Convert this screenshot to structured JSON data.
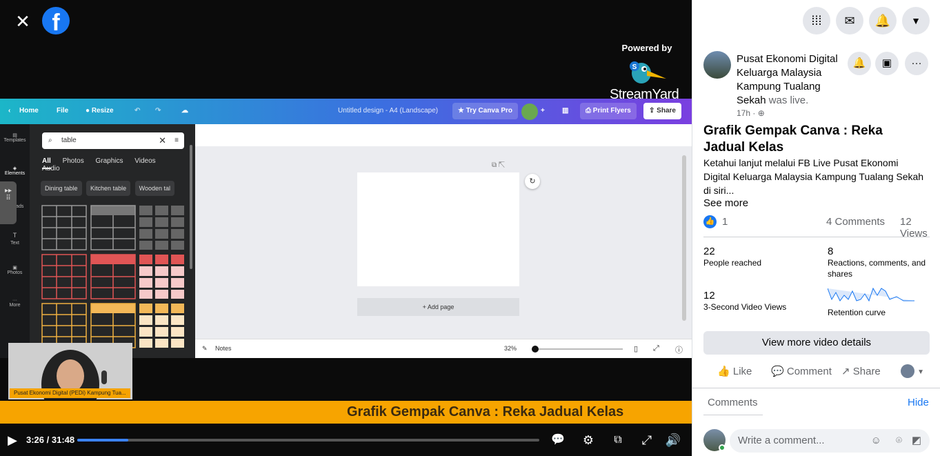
{
  "video": {
    "close_label": "✕",
    "logo": "f",
    "streamyard_powered": "Powered by",
    "streamyard_brand": "StreamYard",
    "canva": {
      "home": "Home",
      "file": "File",
      "resize": "Resize",
      "doc_title": "Untitled design - A4 (Landscape)",
      "try_pro": "Try Canva Pro",
      "print": "Print Flyers",
      "share": "Share",
      "rail": [
        "Templates",
        "Elements",
        "Uploads",
        "Text",
        "Photos",
        "More"
      ],
      "search_value": "table",
      "tabs": [
        "All",
        "Photos",
        "Graphics",
        "Videos",
        "Audio"
      ],
      "chips": [
        "Dining table",
        "Kitchen table",
        "Wooden tal"
      ],
      "add_page": "+ Add page",
      "notes": "Notes",
      "zoom": "32%"
    },
    "cam_label": "Pusat Ekonomi Digital (PEDi) Kampung Tua...",
    "banner": "Grafik Gempak Canva : Reka Jadual Kelas",
    "time": "3:26 / 31:48",
    "progress": 0.11
  },
  "sidebar": {
    "page_name": "Pusat Ekonomi Digital Keluarga Malaysia Kampung Tualang Sekah",
    "was_live": "was live.",
    "time_ago": "17h ·",
    "title": "Grafik Gempak Canva : Reka Jadual Kelas",
    "description": "Ketahui lanjut melalui FB Live Pusat Ekonomi Digital Keluarga Malaysia Kampung Tualang Sekah di siri...",
    "see_more": "See more",
    "like_count": "1",
    "comments_count": "4 Comments",
    "views_count": "12 Views",
    "stats": [
      {
        "value": "22",
        "label": "People reached"
      },
      {
        "value": "8",
        "label": "Reactions, comments, and shares"
      },
      {
        "value": "12",
        "label": "3-Second Video Views"
      },
      {
        "value": "",
        "label": "Retention curve"
      }
    ],
    "view_more": "View more video details",
    "actions": [
      "Like",
      "Comment",
      "Share"
    ],
    "comments_header": "Comments",
    "hide": "Hide",
    "comment_placeholder": "Write a comment..."
  },
  "colors": {
    "fb_blue": "#1877f2",
    "banner": "#f7a400"
  }
}
